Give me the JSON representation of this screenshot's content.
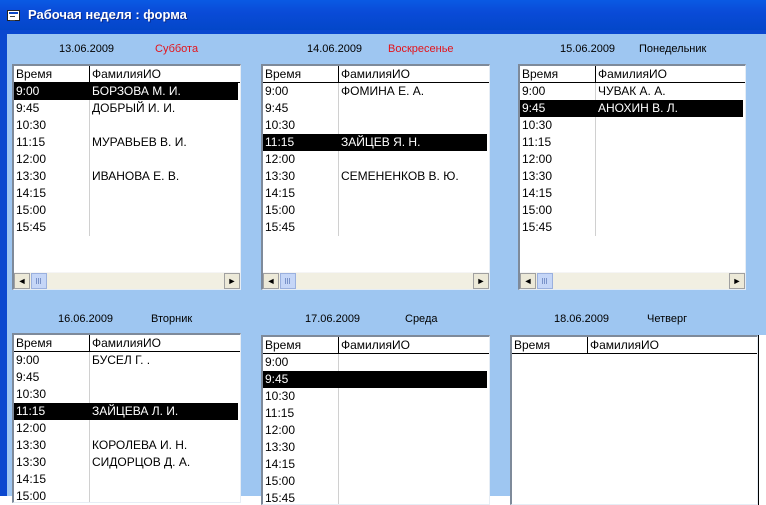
{
  "window": {
    "title": "Рабочая неделя : форма",
    "icon": "form-window-icon"
  },
  "columns": {
    "time": "Время",
    "name": "ФамилияИО"
  },
  "days": [
    {
      "date": "13.06.2009",
      "weekday": "Суббота",
      "weekend": true,
      "rows": [
        {
          "time": "9:00",
          "name": "БОРЗОВА М. И.",
          "selected": true
        },
        {
          "time": "9:45",
          "name": "ДОБРЫЙ И. И."
        },
        {
          "time": "10:30",
          "name": ""
        },
        {
          "time": "11:15",
          "name": "МУРАВЬЕВ В. И."
        },
        {
          "time": "12:00",
          "name": ""
        },
        {
          "time": "13:30",
          "name": "ИВАНОВА Е. В."
        },
        {
          "time": "14:15",
          "name": ""
        },
        {
          "time": "15:00",
          "name": ""
        },
        {
          "time": "15:45",
          "name": ""
        }
      ]
    },
    {
      "date": "14.06.2009",
      "weekday": "Воскресенье",
      "weekend": true,
      "rows": [
        {
          "time": "9:00",
          "name": "ФОМИНА Е. А."
        },
        {
          "time": "9:45",
          "name": ""
        },
        {
          "time": "10:30",
          "name": ""
        },
        {
          "time": "11:15",
          "name": "ЗАЙЦЕВ Я. Н.",
          "selected": true
        },
        {
          "time": "12:00",
          "name": ""
        },
        {
          "time": "13:30",
          "name": "СЕМЕНЕНКОВ В. Ю."
        },
        {
          "time": "14:15",
          "name": ""
        },
        {
          "time": "15:00",
          "name": ""
        },
        {
          "time": "15:45",
          "name": ""
        }
      ]
    },
    {
      "date": "15.06.2009",
      "weekday": "Понедельник",
      "weekend": false,
      "rows": [
        {
          "time": "9:00",
          "name": "ЧУВАК А. А."
        },
        {
          "time": "9:45",
          "name": "АНОХИН В. Л.",
          "selected": true
        },
        {
          "time": "10:30",
          "name": ""
        },
        {
          "time": "11:15",
          "name": ""
        },
        {
          "time": "12:00",
          "name": ""
        },
        {
          "time": "13:30",
          "name": ""
        },
        {
          "time": "14:15",
          "name": ""
        },
        {
          "time": "15:00",
          "name": ""
        },
        {
          "time": "15:45",
          "name": ""
        }
      ]
    },
    {
      "date": "16.06.2009",
      "weekday": "Вторник",
      "weekend": false,
      "rows": [
        {
          "time": "9:00",
          "name": "БУСЕЛ Г. ."
        },
        {
          "time": "9:45",
          "name": ""
        },
        {
          "time": "10:30",
          "name": ""
        },
        {
          "time": "11:15",
          "name": "ЗАЙЦЕВА Л. И.",
          "selected": true
        },
        {
          "time": "12:00",
          "name": ""
        },
        {
          "time": "13:30",
          "name": "КОРОЛЕВА И. Н."
        },
        {
          "time": "13:30",
          "name": "СИДОРЦОВ Д. А."
        },
        {
          "time": "14:15",
          "name": ""
        },
        {
          "time": "15:00",
          "name": ""
        }
      ]
    },
    {
      "date": "17.06.2009",
      "weekday": "Среда",
      "weekend": false,
      "rows": [
        {
          "time": "9:00",
          "name": ""
        },
        {
          "time": "9:45",
          "name": "",
          "selected": true
        },
        {
          "time": "10:30",
          "name": ""
        },
        {
          "time": "11:15",
          "name": ""
        },
        {
          "time": "12:00",
          "name": ""
        },
        {
          "time": "13:30",
          "name": ""
        },
        {
          "time": "14:15",
          "name": ""
        },
        {
          "time": "15:00",
          "name": ""
        },
        {
          "time": "15:45",
          "name": ""
        }
      ]
    },
    {
      "date": "18.06.2009",
      "weekday": "Четверг",
      "weekend": false,
      "rows": []
    }
  ],
  "colors": {
    "weekend_text": "#e4141b",
    "selection": "#000000",
    "client_bg": "#9ec6f1",
    "titlebar": "#0a4bd8"
  },
  "scrollbar": {
    "left_arrow": "◄",
    "right_arrow": "►"
  }
}
